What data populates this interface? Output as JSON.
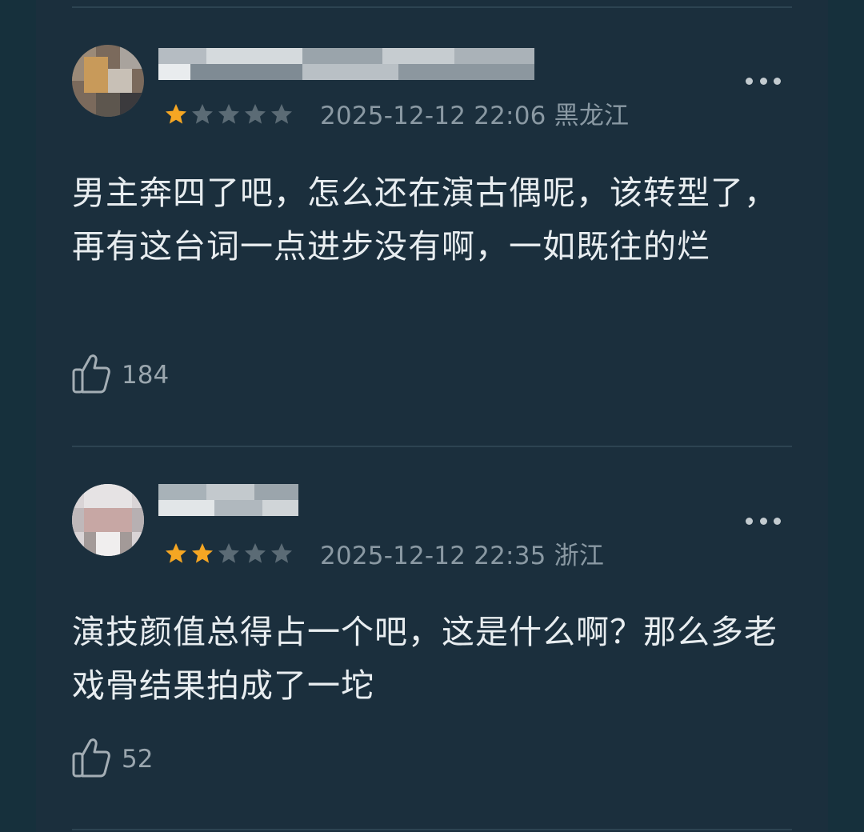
{
  "comments": [
    {
      "rating": 1,
      "max_rating": 5,
      "datetime": "2025-12-12 22:06",
      "location": "黑龙江",
      "text": "男主奔四了吧，怎么还在演古偶呢，该转型了，再有这台词一点进步没有啊，一如既往的烂",
      "likes": "184"
    },
    {
      "rating": 2,
      "max_rating": 5,
      "datetime": "2025-12-12 22:35",
      "location": "浙江",
      "text": "演技颜值总得占一个吧，这是什么啊？那么多老戏骨结果拍成了一坨",
      "likes": "52"
    }
  ],
  "icons": {
    "more": "more-dots-icon",
    "like": "thumbs-up-icon",
    "star": "star-icon"
  },
  "colors": {
    "star_filled": "#f5a623",
    "star_empty": "#5b6b75",
    "background": "#1b2f3d",
    "text": "#e8edf0",
    "meta": "#8a99a3"
  }
}
